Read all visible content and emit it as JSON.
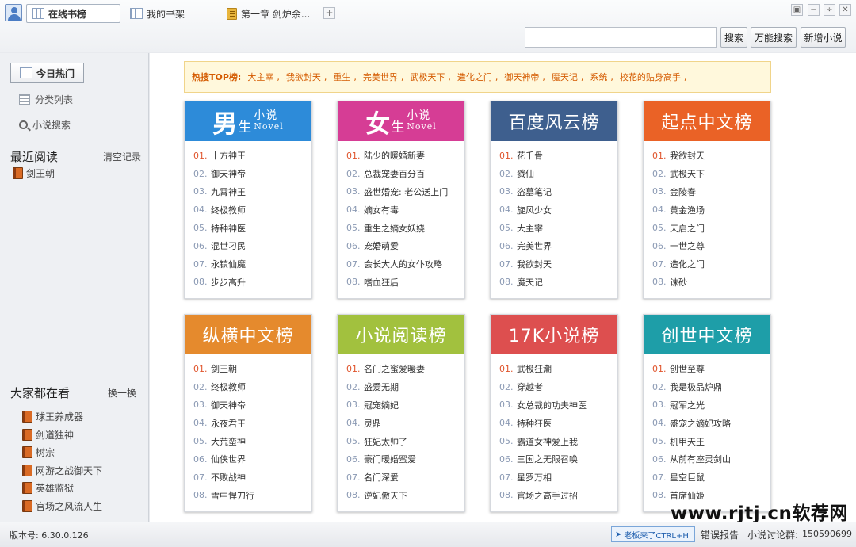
{
  "tabs": {
    "online": "在线书榜",
    "shelf": "我的书架",
    "chapter": "第一章  剑炉余..."
  },
  "window_controls": [
    "restore-icon",
    "minimize-icon",
    "tile-icon",
    "close-icon"
  ],
  "toolbar": {
    "search_value": "",
    "search_label": "搜索",
    "super_search_label": "万能搜索",
    "add_novel_label": "新增小说"
  },
  "sidebar": {
    "today_hot": "今日热门",
    "category_list": "分类列表",
    "novel_search": "小说搜索",
    "recent_title": "最近阅读",
    "clear_label": "清空记录",
    "recent_items": [
      "剑王朝"
    ],
    "popular_title": "大家都在看",
    "refresh_label": "换一换",
    "popular_items": [
      "球王养成器",
      "剑道独神",
      "树宗",
      "网游之战御天下",
      "英雄监狱",
      "官场之风流人生"
    ]
  },
  "hot_search": {
    "label": "热搜TOP榜:",
    "keywords": [
      "大主宰",
      "我欲封天",
      "重生",
      "完美世界",
      "武极天下",
      "造化之门",
      "御天神帝",
      "魔天记",
      "系统",
      "校花的贴身高手"
    ]
  },
  "colors": {
    "male": "#2d8bd9",
    "female": "#d63d95",
    "baidu": "#3e5f8e",
    "qidian": "#ea6226",
    "zongheng": "#e58a2d",
    "xiaoshuo": "#a2c13e",
    "k17": "#dd4f4f",
    "chuangshi": "#1e9ea8"
  },
  "charts": [
    {
      "title_big": "男",
      "title_mid": "生",
      "title_s1": "小说",
      "title_s2": "Novel",
      "color_key": "male",
      "items": [
        "十方神王",
        "御天神帝",
        "九霄神王",
        "终极教师",
        "特种神医",
        "混世刁民",
        "永镇仙魔",
        "步步高升"
      ]
    },
    {
      "title_big": "女",
      "title_mid": "生",
      "title_s1": "小说",
      "title_s2": "Novel",
      "color_key": "female",
      "items": [
        "陆少的暖婚新妻",
        "总裁宠妻百分百",
        "盛世婚宠: 老公送上门",
        "嫡女有毒",
        "重生之嫡女妖娆",
        "宠婚萌爱",
        "会长大人的女仆攻略",
        "嗜血狂后"
      ]
    },
    {
      "title": "百度风云榜",
      "color_key": "baidu",
      "items": [
        "花千骨",
        "戮仙",
        "盗墓笔记",
        "旋风少女",
        "大主宰",
        "完美世界",
        "我欲封天",
        "魔天记"
      ]
    },
    {
      "title": "起点中文榜",
      "color_key": "qidian",
      "items": [
        "我欲封天",
        "武极天下",
        "金陵春",
        "黄金渔场",
        "天启之门",
        "一世之尊",
        "造化之门",
        "诛砂"
      ]
    },
    {
      "title": "纵横中文榜",
      "color_key": "zongheng",
      "items": [
        "剑王朝",
        "终极教师",
        "御天神帝",
        "永夜君王",
        "大荒蛮神",
        "仙侠世界",
        "不败战神",
        "雪中悍刀行"
      ]
    },
    {
      "title": "小说阅读榜",
      "color_key": "xiaoshuo",
      "items": [
        "名门之蜜爱暖妻",
        "盛爱无期",
        "冠宠嫡妃",
        "灵鼎",
        "狂妃太帅了",
        "豪门暖婚蜜爱",
        "名门深爱",
        "逆妃傲天下"
      ]
    },
    {
      "title": "17K小说榜",
      "color_key": "k17",
      "items": [
        "武极狂潮",
        "穿越者",
        "女总裁的功夫神医",
        "特种狂医",
        "霸道女神爱上我",
        "三国之无限召唤",
        "星罗万相",
        "官场之高手过招"
      ]
    },
    {
      "title": "创世中文榜",
      "color_key": "chuangshi",
      "items": [
        "创世至尊",
        "我是极品炉鼎",
        "冠军之光",
        "盛宠之嫡妃攻略",
        "机甲天王",
        "从前有座灵剑山",
        "星空巨鼠",
        "首席仙姬"
      ]
    }
  ],
  "numbers": [
    "01.",
    "02.",
    "03.",
    "04.",
    "05.",
    "06.",
    "07.",
    "08."
  ],
  "status": {
    "version": "版本号: 6.30.0.126",
    "boss_label": "老板来了CTRL+H",
    "error_report": "错误报告",
    "group_label": "小说讨论群:",
    "group_number": "150590699"
  },
  "watermark": "www.rjtj.cn软荐网"
}
